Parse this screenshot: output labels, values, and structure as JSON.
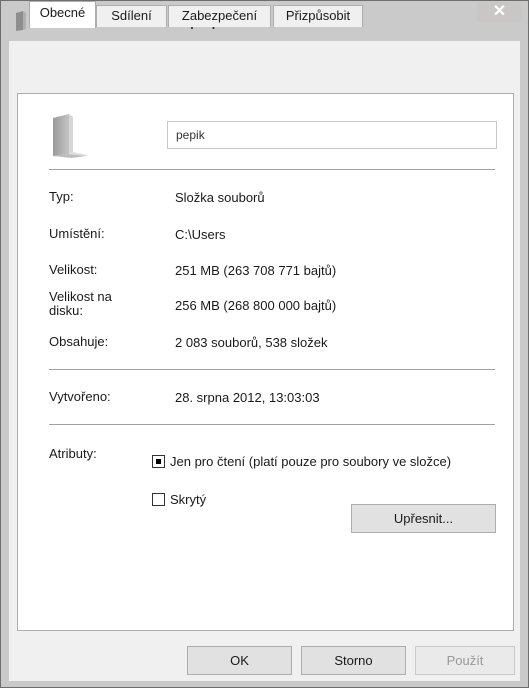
{
  "window": {
    "title": "pepik – vlastnosti",
    "close_glyph": "✕"
  },
  "tabs": [
    {
      "label": "Obecné",
      "active": true
    },
    {
      "label": "Sdílení",
      "active": false
    },
    {
      "label": "Zabezpečení",
      "active": false
    },
    {
      "label": "Přizpůsobit",
      "active": false
    }
  ],
  "general": {
    "name_value": "pepik",
    "rows": {
      "type": {
        "label": "Typ:",
        "value": "Složka souborů"
      },
      "location": {
        "label": "Umístění:",
        "value": "C:\\Users"
      },
      "size": {
        "label": "Velikost:",
        "value": "251 MB (263 708 771 bajtů)"
      },
      "size_on_disk": {
        "label_line1": "Velikost na",
        "label_line2": "disku:",
        "value": "256 MB (268 800 000 bajtů)"
      },
      "contains": {
        "label": "Obsahuje:",
        "value": "2 083 souborů, 538 složek"
      },
      "created": {
        "label": "Vytvořeno:",
        "value": "28. srpna 2012, 13:03:03"
      }
    },
    "attributes": {
      "label": "Atributy:",
      "readonly": {
        "label": "Jen pro čtení (platí pouze pro soubory ve složce)",
        "state": "indeterminate"
      },
      "hidden": {
        "label": "Skrytý",
        "state": "unchecked"
      },
      "advanced_button": "Upřesnit..."
    }
  },
  "buttons": {
    "ok": "OK",
    "cancel": "Storno",
    "apply": "Použít"
  }
}
